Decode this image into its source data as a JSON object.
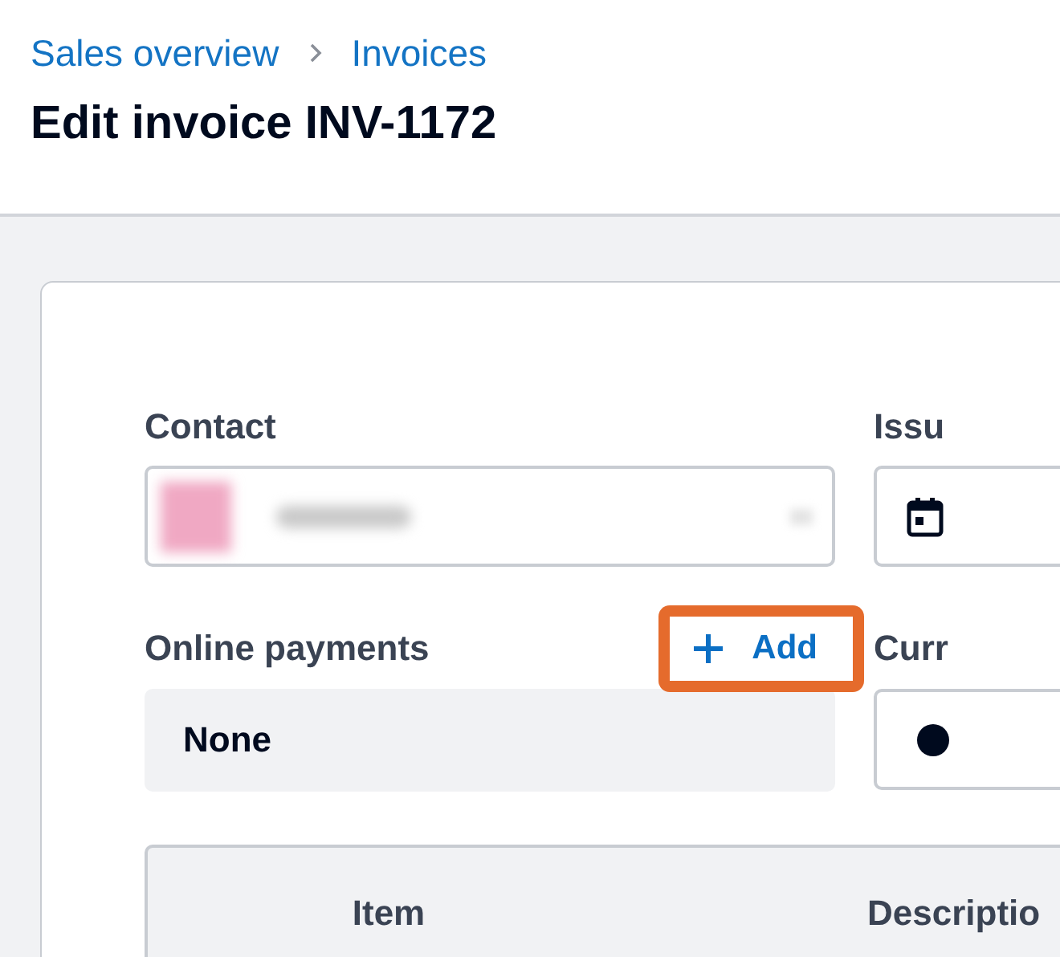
{
  "breadcrumbs": [
    {
      "label": "Sales overview"
    },
    {
      "label": "Invoices"
    }
  ],
  "title": "Edit invoice INV-1172",
  "form": {
    "contact": {
      "label": "Contact"
    },
    "issue_date": {
      "label": "Issu"
    },
    "online_payments": {
      "label": "Online payments",
      "add_button": "Add",
      "value": "None",
      "highlighted": true
    },
    "currency": {
      "label": "Curr"
    }
  },
  "table": {
    "columns": [
      "Item",
      "Descriptio"
    ]
  }
}
